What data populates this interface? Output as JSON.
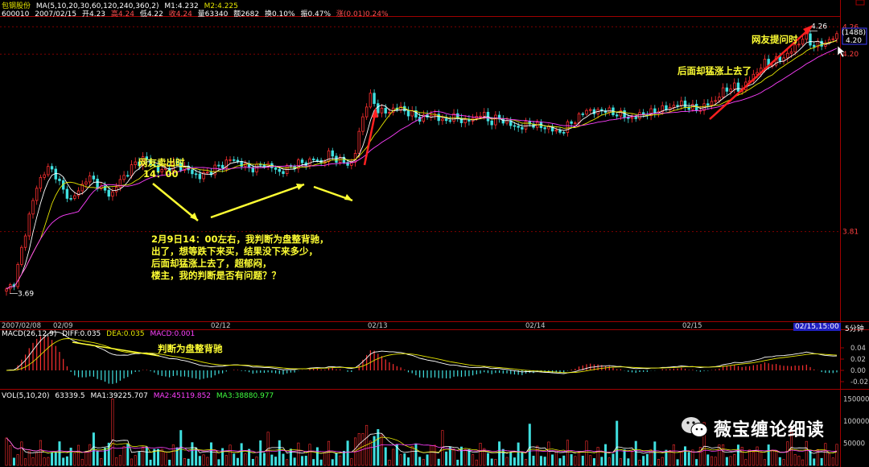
{
  "header": {
    "name": "包钢股份",
    "ma_spec": "MA(5,10,20,30,60,120,240,360,2)",
    "m1": "M1:4.232",
    "m2": "M2:4.225",
    "code": "600010",
    "date": "2007/02/15",
    "open": "开4.23",
    "high": "高4.24",
    "low": "低4.22",
    "close": "收4.24",
    "volume": "量63340",
    "amount": "额2682",
    "turnover": "换0.10%",
    "amplitude": "振0.47%",
    "change": "涨(0.01)0.24%"
  },
  "macd_header": {
    "spec": "MACD(26,12,9)",
    "diff": "DIFF:0.035",
    "dea": "DEA:0.035",
    "macd": "MACD:0.001"
  },
  "vol_header": {
    "spec": "VOL(5,10,20)",
    "val": "63339.5",
    "ma1": "MA1:39225.707",
    "ma2": "MA2:45119.852",
    "ma3": "MA3:38880.977"
  },
  "price_right": {
    "tag_label": "(1488)",
    "current": "4.20"
  },
  "period": "5分钟",
  "time_readout": "02/15,15:00",
  "annotations": {
    "sell_title": "网友卖出时",
    "sell_time": "14：00",
    "buy_back": "网友提问时",
    "surge": "后面却猛涨上去了",
    "macd_note": "判断为盘整背驰",
    "question": [
      "2月9日14：00左右，我判断为盘整背驰，",
      "出了，想等跌下来买，结果没下来多少，",
      "后面却猛涨上去了，超郁闷，",
      "楼主，我的判断是否有问题？？"
    ]
  },
  "watermark": "薇宝缠论细读",
  "colors": {
    "up": "#ff3030",
    "down": "#40e0e0",
    "ma1": "#ffffff",
    "ma2": "#e6e600",
    "ma3": "#ff40ff",
    "annotation": "#ffff33",
    "grid": "#800000"
  },
  "chart_data": {
    "type": "candlestick",
    "price_axis": {
      "ticks": [
        3.81,
        4.2,
        4.26
      ],
      "labels": [
        "3.81",
        "4.20",
        "4.26"
      ],
      "ylim": [
        3.62,
        4.28
      ]
    },
    "x_ticks": [
      "2007/02/08",
      "02/09",
      "02/12",
      "02/13",
      "02/14",
      "02/15"
    ],
    "price_labels": {
      "low": {
        "value": 3.69,
        "label": "3.69"
      },
      "high": {
        "value": 4.26,
        "label": "4.26"
      }
    },
    "close_path": [
      3.68,
      3.7,
      3.78,
      3.86,
      3.92,
      3.95,
      3.94,
      3.9,
      3.88,
      3.9,
      3.93,
      3.92,
      3.9,
      3.89,
      3.92,
      3.94,
      3.96,
      3.97,
      3.96,
      3.94,
      3.95,
      3.96,
      3.95,
      3.94,
      3.93,
      3.94,
      3.95,
      3.96,
      3.97,
      3.96,
      3.95,
      3.95,
      3.96,
      3.95,
      3.94,
      3.95,
      3.96,
      3.96,
      3.97,
      3.96,
      3.98,
      3.97,
      3.96,
      3.96,
      4.05,
      4.11,
      4.08,
      4.07,
      4.08,
      4.08,
      4.07,
      4.06,
      4.06,
      4.07,
      4.05,
      4.06,
      4.06,
      4.05,
      4.06,
      4.07,
      4.05,
      4.06,
      4.05,
      4.04,
      4.04,
      4.05,
      4.04,
      4.04,
      4.03,
      4.03,
      4.05,
      4.06,
      4.08,
      4.07,
      4.08,
      4.07,
      4.07,
      4.06,
      4.06,
      4.07,
      4.07,
      4.08,
      4.08,
      4.09,
      4.09,
      4.08,
      4.08,
      4.09,
      4.1,
      4.12,
      4.13,
      4.12,
      4.14,
      4.16,
      4.18,
      4.18,
      4.19,
      4.2,
      4.22,
      4.24,
      4.22,
      4.22,
      4.23,
      4.24
    ],
    "macd_axis": {
      "ticks": [
        0.04,
        0.02,
        0.0,
        -0.02
      ],
      "labels": [
        "0.04",
        "0.02",
        "0.00",
        "-0.02"
      ]
    },
    "vol_axis": {
      "ticks": [
        150000,
        100000,
        50000
      ],
      "labels": [
        "150000",
        "100000",
        "50000"
      ]
    }
  }
}
